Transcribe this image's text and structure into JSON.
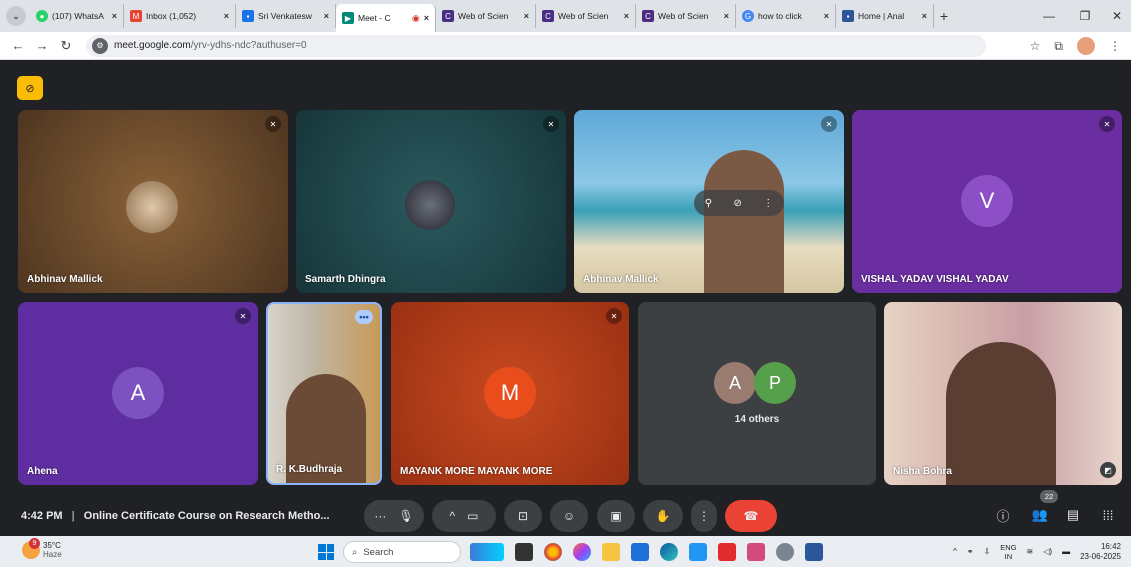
{
  "browser": {
    "tabs": [
      {
        "label": "(107) WhatsA",
        "icon_color": "#25d366",
        "active": false
      },
      {
        "label": "Inbox (1,052)",
        "icon_color": "#ea4335",
        "active": false
      },
      {
        "label": "Sri Venkatesw",
        "icon_color": "#1a73e8",
        "active": false
      },
      {
        "label": "Meet - C",
        "icon_color": "#00897b",
        "active": true
      },
      {
        "label": "Web of Scien",
        "icon_color": "#4b2e83",
        "active": false
      },
      {
        "label": "Web of Scien",
        "icon_color": "#4b2e83",
        "active": false
      },
      {
        "label": "Web of Scien",
        "icon_color": "#4b2e83",
        "active": false
      },
      {
        "label": "how to click",
        "icon_color": "#4285f4",
        "active": false
      },
      {
        "label": "Home | Anal",
        "icon_color": "#2b579a",
        "active": false
      }
    ],
    "url_host": "meet.google.com",
    "url_path": "/yrv-ydhs-ndc?authuser=0"
  },
  "meeting": {
    "participants": [
      {
        "name": "Abhinav Mallick",
        "bg": "#6b4a2a",
        "type": "photo",
        "muted": true
      },
      {
        "name": "Samarth Dhingra",
        "bg": "#1f4a4e",
        "type": "photo",
        "muted": true
      },
      {
        "name": "Abhinav Mallick",
        "bg": "#4f9ac4",
        "type": "video",
        "muted": true
      },
      {
        "name": "VISHAL YADAV VISHAL YADAV",
        "initial": "V",
        "bg": "#6a2ea1",
        "avatar_color": "#8c4fc6",
        "type": "initial",
        "muted": true
      },
      {
        "name": "Ahena",
        "initial": "A",
        "bg": "#5e2ea0",
        "avatar_color": "#7c52c0",
        "type": "initial",
        "muted": true
      },
      {
        "name": "R. K.Budhraja",
        "bg": "#8a7d66",
        "type": "video",
        "muted": false
      },
      {
        "name": "MAYANK MORE MAYANK MORE",
        "initial": "M",
        "bg": "#b8401c",
        "avatar_color": "#ea4d1c",
        "type": "initial",
        "muted": true
      },
      {
        "name": "Nisha Bohra",
        "bg": "#c9b8b8",
        "type": "video",
        "muted": false
      }
    ],
    "others": {
      "initials": [
        "A",
        "P"
      ],
      "colors": [
        "#9a7b6f",
        "#57a04b"
      ],
      "label": "14 others"
    },
    "time": "4:42 PM",
    "title": "Online Certificate Course on Research Metho...",
    "people_count": "22"
  },
  "taskbar": {
    "weather_temp": "35°C",
    "weather_cond": "Haze",
    "weather_badge": "9",
    "search_label": "Search",
    "lang_top": "ENG",
    "lang_bottom": "IN",
    "clock_time": "16:42",
    "clock_date": "23-06-2025"
  }
}
